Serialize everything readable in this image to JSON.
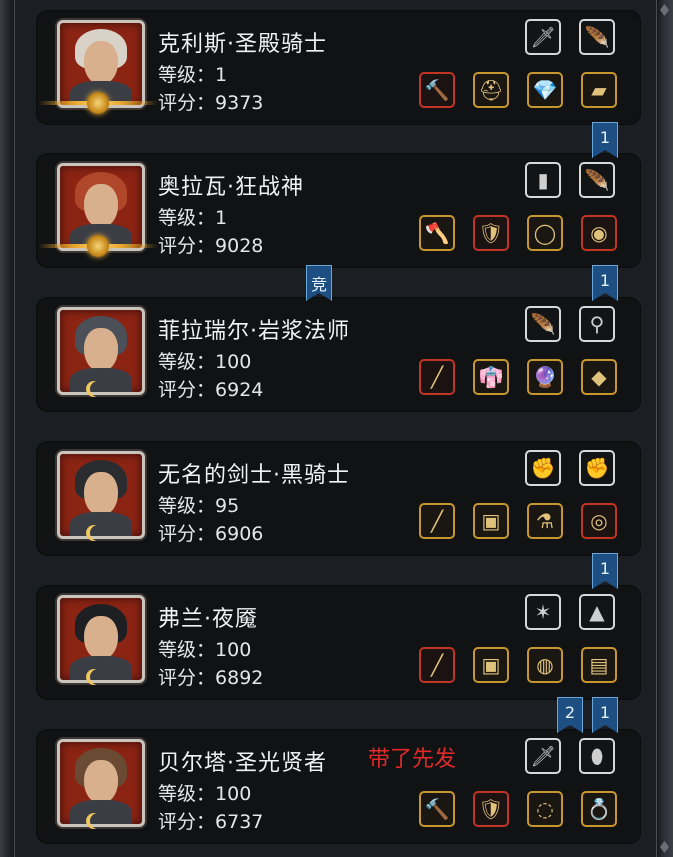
{
  "accent": {
    "gold": "#c7962e",
    "red": "#c23424",
    "white": "#d8d8d8",
    "note_red": "#e02a2a",
    "tag_blue": "#1d4f82"
  },
  "labels": {
    "level_prefix": "等级：",
    "score_prefix": "评分："
  },
  "heroes": [
    {
      "name": "克利斯·圣殿骑士",
      "level": "1",
      "score": "9373",
      "note": "",
      "hair_color": "#d8d2c8",
      "top_slots": [
        {
          "icon": "dagger-icon",
          "glyph": "🗡",
          "frame": "white"
        },
        {
          "icon": "wing-icon",
          "glyph": "🪶",
          "frame": "white"
        }
      ],
      "bottom_slots": [
        {
          "icon": "hammer-icon",
          "glyph": "🔨",
          "frame": "red"
        },
        {
          "icon": "helmet-icon",
          "glyph": "⛑",
          "frame": "gold"
        },
        {
          "icon": "gem-icon",
          "glyph": "💎",
          "frame": "gold"
        },
        {
          "icon": "bracer-icon",
          "glyph": "▰",
          "frame": "gold"
        }
      ],
      "tags": [
        "1"
      ]
    },
    {
      "name": "奥拉瓦·狂战神",
      "level": "1",
      "score": "9028",
      "note": "",
      "hair_color": "#b0462a",
      "top_slots": [
        {
          "icon": "tome-icon",
          "glyph": "▮",
          "frame": "white"
        },
        {
          "icon": "feather-icon",
          "glyph": "🪶",
          "frame": "white"
        }
      ],
      "bottom_slots": [
        {
          "icon": "axe-icon",
          "glyph": "🪓",
          "frame": "gold"
        },
        {
          "icon": "armor-icon",
          "glyph": "🛡",
          "frame": "red"
        },
        {
          "icon": "ring-icon",
          "glyph": "◯",
          "frame": "gold"
        },
        {
          "icon": "amulet-icon",
          "glyph": "◉",
          "frame": "red"
        }
      ],
      "tags": [
        "1"
      ]
    },
    {
      "name": "菲拉瑞尔·岩浆法师",
      "level": "100",
      "score": "6924",
      "note": "",
      "hair_color": "#4a4f58",
      "top_slots": [
        {
          "icon": "quill-icon",
          "glyph": "🪶",
          "frame": "white"
        },
        {
          "icon": "necklace-icon",
          "glyph": "⚲",
          "frame": "white"
        }
      ],
      "bottom_slots": [
        {
          "icon": "staff-icon",
          "glyph": "╱",
          "frame": "red"
        },
        {
          "icon": "robe-icon",
          "glyph": "👘",
          "frame": "gold"
        },
        {
          "icon": "orb-icon",
          "glyph": "🔮",
          "frame": "gold"
        },
        {
          "icon": "stone-icon",
          "glyph": "◆",
          "frame": "gold"
        }
      ],
      "tags": []
    },
    {
      "name": "无名的剑士·黑骑士",
      "level": "95",
      "score": "6906",
      "note": "",
      "hair_color": "#2a2c30",
      "top_slots": [
        {
          "icon": "gauntlet-icon",
          "glyph": "✊",
          "frame": "white"
        },
        {
          "icon": "gauntlet-icon",
          "glyph": "✊",
          "frame": "white"
        }
      ],
      "bottom_slots": [
        {
          "icon": "spear-icon",
          "glyph": "╱",
          "frame": "gold"
        },
        {
          "icon": "chestplate-icon",
          "glyph": "▣",
          "frame": "gold"
        },
        {
          "icon": "potion-icon",
          "glyph": "⚗",
          "frame": "gold"
        },
        {
          "icon": "medallion-icon",
          "glyph": "◎",
          "frame": "red"
        }
      ],
      "tags": []
    },
    {
      "name": "弗兰·夜魇",
      "level": "100",
      "score": "6892",
      "note": "",
      "hair_color": "#1e1f22",
      "top_slots": [
        {
          "icon": "sigil-icon",
          "glyph": "✶",
          "frame": "white"
        },
        {
          "icon": "hood-icon",
          "glyph": "▲",
          "frame": "white"
        }
      ],
      "bottom_slots": [
        {
          "icon": "lance-icon",
          "glyph": "╱",
          "frame": "red"
        },
        {
          "icon": "vest-icon",
          "glyph": "▣",
          "frame": "gold"
        },
        {
          "icon": "coin-ring-icon",
          "glyph": "◍",
          "frame": "gold"
        },
        {
          "icon": "cloak-icon",
          "glyph": "▤",
          "frame": "gold"
        }
      ],
      "tags": [
        "1"
      ]
    },
    {
      "name": "贝尔塔·圣光贤者",
      "level": "100",
      "score": "6737",
      "note": "带了先发",
      "hair_color": "#6a4a32",
      "top_slots": [
        {
          "icon": "knife-icon",
          "glyph": "🗡",
          "frame": "white"
        },
        {
          "icon": "jade-icon",
          "glyph": "⬮",
          "frame": "white"
        }
      ],
      "bottom_slots": [
        {
          "icon": "mace-icon",
          "glyph": "🔨",
          "frame": "gold"
        },
        {
          "icon": "armor-icon",
          "glyph": "🛡",
          "frame": "red"
        },
        {
          "icon": "bracelet-icon",
          "glyph": "◌",
          "frame": "gold"
        },
        {
          "icon": "sapphire-ring-icon",
          "glyph": "💍",
          "frame": "gold"
        }
      ],
      "tags": [
        "2",
        "1"
      ]
    }
  ],
  "between_tags": [
    {
      "after_card": 0,
      "labels": [
        "1"
      ]
    },
    {
      "after_card": 1,
      "labels": [
        "竞",
        "1"
      ]
    },
    {
      "after_card": 3,
      "labels": [
        "1"
      ]
    },
    {
      "after_card": 4,
      "labels": [
        "2",
        "1"
      ]
    }
  ]
}
